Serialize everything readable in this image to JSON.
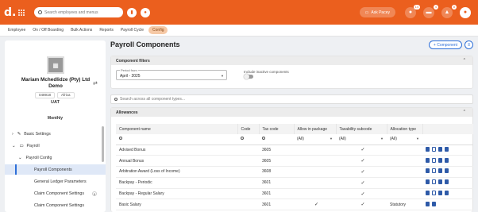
{
  "topbar": {
    "logo": "d.",
    "search_placeholder": "Search employees and menus",
    "ask_label": "Ask Pacey",
    "badges": [
      "14",
      "4",
      "8"
    ]
  },
  "nav": {
    "items": [
      "Employee",
      "On / Off Boarding",
      "Bulk Actions",
      "Reports",
      "Payroll Cycle",
      "Config"
    ],
    "active_index": 5
  },
  "sidebar": {
    "company_name": "Mariam Mchedlidze (Pty) Ltd Demo",
    "company_code": "048918",
    "region": "Africa",
    "environment": "UAT",
    "frequency": "Monthly",
    "items": [
      {
        "label": "Basic Settings"
      },
      {
        "label": "Payroll"
      },
      {
        "label": "Payroll Config"
      },
      {
        "label": "Payroll Components"
      },
      {
        "label": "General Ledger Parameters"
      },
      {
        "label": "Claim Component Settings",
        "count": "0"
      },
      {
        "label": "Claim Component Settings"
      }
    ]
  },
  "page": {
    "title": "Payroll Components",
    "add_component_label": "+ Component"
  },
  "filters": {
    "heading": "Component filters",
    "period_label": "Period from",
    "period_value": "April - 2025",
    "inactive_label": "Include inactive components",
    "search_all_placeholder": "Search across all component types..."
  },
  "allowances": {
    "heading": "Allowances",
    "columns": [
      "Component name",
      "Code",
      "Tax code",
      "Allow in package",
      "Taxability subcode",
      "Allocation type"
    ],
    "filter_values": [
      "(All)",
      "(All)",
      "(All)"
    ],
    "rows": [
      {
        "name": "Advised Bonus",
        "code": "",
        "tax": "3605",
        "pkg": "",
        "taxsub": "✓",
        "alloc": ""
      },
      {
        "name": "Annual Bonus",
        "code": "",
        "tax": "3605",
        "pkg": "",
        "taxsub": "✓",
        "alloc": ""
      },
      {
        "name": "Arbitration Award (Loss of Income)",
        "code": "",
        "tax": "3608",
        "pkg": "",
        "taxsub": "✓",
        "alloc": ""
      },
      {
        "name": "Backpay - Periodic",
        "code": "",
        "tax": "3601",
        "pkg": "",
        "taxsub": "✓",
        "alloc": ""
      },
      {
        "name": "Backpay - Regular Salary",
        "code": "",
        "tax": "3601",
        "pkg": "",
        "taxsub": "✓",
        "alloc": ""
      },
      {
        "name": "Basic Salary",
        "code": "",
        "tax": "3601",
        "pkg": "✓",
        "taxsub": "✓",
        "alloc": "Statutory"
      }
    ]
  }
}
